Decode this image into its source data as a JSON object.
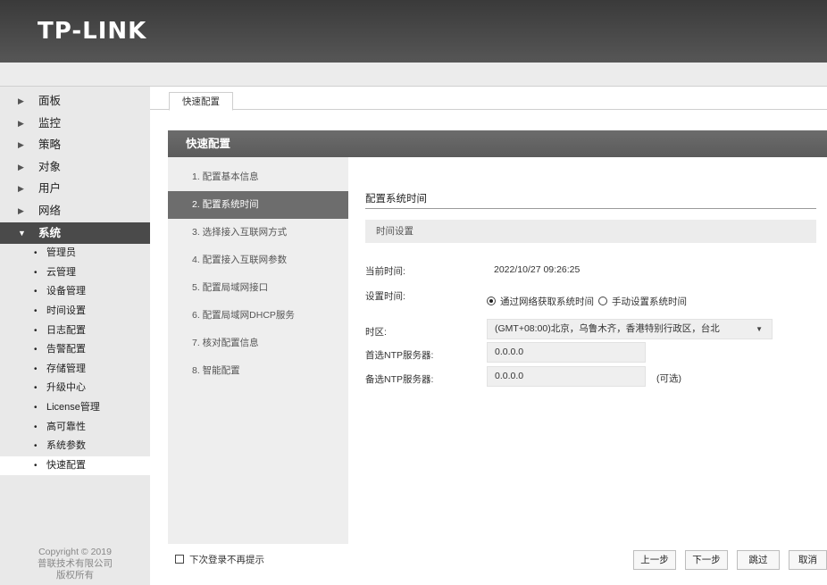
{
  "header": {
    "logo": "TP-LINK"
  },
  "sidebar": {
    "items": [
      {
        "label": "面板"
      },
      {
        "label": "监控"
      },
      {
        "label": "策略"
      },
      {
        "label": "对象"
      },
      {
        "label": "用户"
      },
      {
        "label": "网络"
      },
      {
        "label": "系统"
      }
    ],
    "sub_items": [
      {
        "label": "管理员"
      },
      {
        "label": "云管理"
      },
      {
        "label": "设备管理"
      },
      {
        "label": "时间设置"
      },
      {
        "label": "日志配置"
      },
      {
        "label": "告警配置"
      },
      {
        "label": "存储管理"
      },
      {
        "label": "升级中心"
      },
      {
        "label": "License管理"
      },
      {
        "label": "高可靠性"
      },
      {
        "label": "系统参数"
      },
      {
        "label": "快速配置"
      }
    ],
    "copyright": [
      "Copyright © 2019",
      "普联技术有限公司",
      "版权所有"
    ]
  },
  "tab": {
    "label": "快速配置"
  },
  "wizard": {
    "title": "快速配置",
    "steps": [
      "1. 配置基本信息",
      "2. 配置系统时间",
      "3. 选择接入互联网方式",
      "4. 配置接入互联网参数",
      "5. 配置局域网接口",
      "6. 配置局域网DHCP服务",
      "7. 核对配置信息",
      "8. 智能配置"
    ],
    "active_step": 2
  },
  "form": {
    "section_title": "配置系统时间",
    "group_title": "时间设置",
    "current_time_label": "当前时间:",
    "current_time_value": "2022/10/27 09:26:25",
    "set_time_label": "设置时间:",
    "radio_network": "通过网络获取系统时间",
    "radio_manual": "手动设置系统时间",
    "timezone_label": "时区:",
    "timezone_value": "(GMT+08:00)北京，乌鲁木齐，香港特别行政区，台北",
    "ntp_primary_label": "首选NTP服务器:",
    "ntp_primary_value": "0.0.0.0",
    "ntp_secondary_label": "备选NTP服务器:",
    "ntp_secondary_value": "0.0.0.0",
    "optional_note": "(可选)"
  },
  "footer": {
    "dont_show_label": "下次登录不再提示",
    "prev_button": "上一步",
    "next_button": "下一步",
    "skip_button": "跳过",
    "cancel_button": "取消"
  }
}
